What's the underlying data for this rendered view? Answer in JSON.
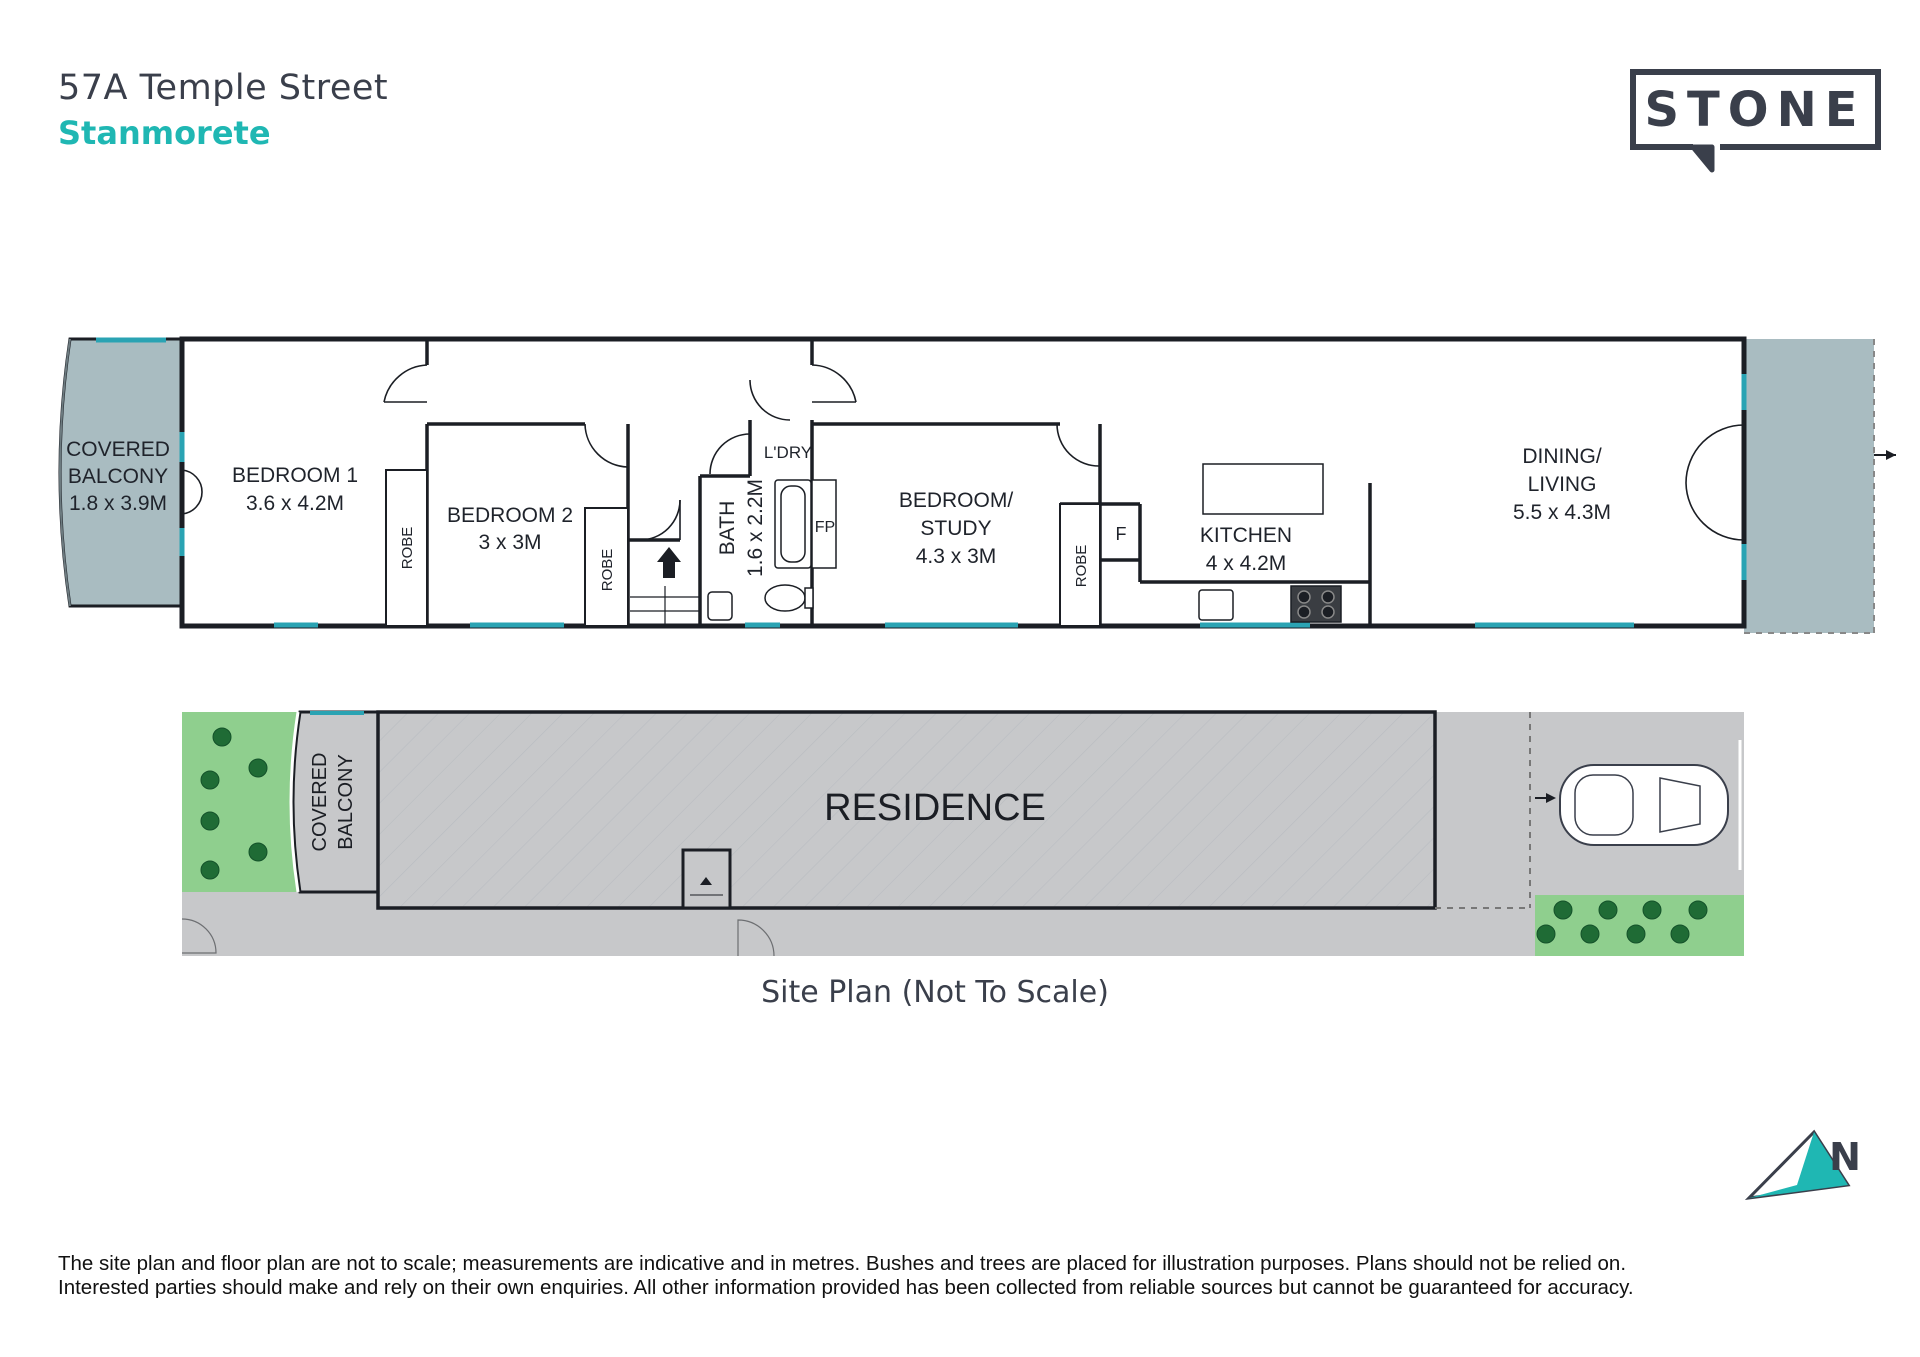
{
  "header": {
    "address": "57A Temple Street",
    "suburb": "Stanmorete"
  },
  "brand": {
    "logo_text": "STONE"
  },
  "compass": {
    "letter": "N"
  },
  "floor_plan": {
    "rooms": [
      {
        "name": "COVERED BALCONY",
        "lines": [
          "COVERED",
          "BALCONY",
          "1.8 x 3.9M"
        ]
      },
      {
        "name": "BEDROOM 1",
        "lines": [
          "BEDROOM 1",
          "3.6 x 4.2M"
        ]
      },
      {
        "name": "BEDROOM 2",
        "lines": [
          "BEDROOM 2",
          "3 x 3M"
        ]
      },
      {
        "name": "BATH",
        "lines": [
          "BATH",
          "1.6 x 2.2M"
        ]
      },
      {
        "name": "L'DRY",
        "lines": [
          "L'DRY"
        ]
      },
      {
        "name": "BEDROOM/ STUDY",
        "lines": [
          "BEDROOM/",
          "STUDY",
          "4.3 x 3M"
        ]
      },
      {
        "name": "KITCHEN",
        "lines": [
          "KITCHEN",
          "4 x 4.2M"
        ]
      },
      {
        "name": "DINING/ LIVING",
        "lines": [
          "DINING/",
          "LIVING",
          "5.5 x 4.3M"
        ]
      }
    ],
    "fixtures": {
      "robe": "ROBE",
      "fp": "FP",
      "fridge": "F"
    }
  },
  "site_plan": {
    "residence": "RESIDENCE",
    "balcony_lines": [
      "COVERED",
      "BALCONY"
    ],
    "caption": "Site Plan (Not To Scale)"
  },
  "disclaimer": [
    "The site plan and floor plan are not to scale; measurements are indicative and in metres. Bushes and trees are placed for illustration purposes. Plans should not be relied on.",
    "Interested parties should make and rely on their own enquiries. All other information provided has been collected from reliable sources but cannot be guaranteed for accuracy."
  ],
  "colors": {
    "accent": "#1fb7b3",
    "wall": "#1b1e24",
    "window": "#2aa3b3",
    "balcony_fill": "#a9bcc1",
    "garden": "#8fcf8e",
    "path": "#c7c8ca",
    "tree": "#1f6b35"
  }
}
